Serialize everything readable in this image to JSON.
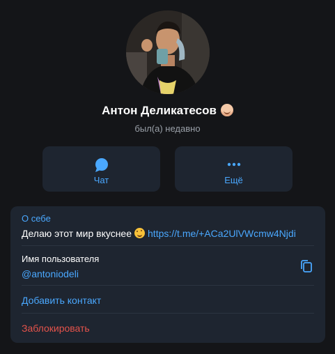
{
  "profile": {
    "name": "Антон Деликатесов",
    "status": "был(а) недавно",
    "name_emoji": "face-emoji"
  },
  "actions": {
    "chat_label": "Чат",
    "more_label": "Ещё"
  },
  "info": {
    "about_title": "О себе",
    "about_text": "Делаю этот мир вкуснее",
    "about_emoji": "smiling-face-emoji",
    "about_link": "https://t.me/+ACa2UlVWcmw4Njdi",
    "username_label": "Имя пользователя",
    "username_value": "@antoniodeli",
    "add_contact_label": "Добавить контакт",
    "block_label": "Заблокировать"
  },
  "colors": {
    "background": "#141518",
    "card": "#1e2530",
    "accent": "#4aa8ff",
    "danger": "#e5534b",
    "secondary_text": "#9aa0a8"
  }
}
